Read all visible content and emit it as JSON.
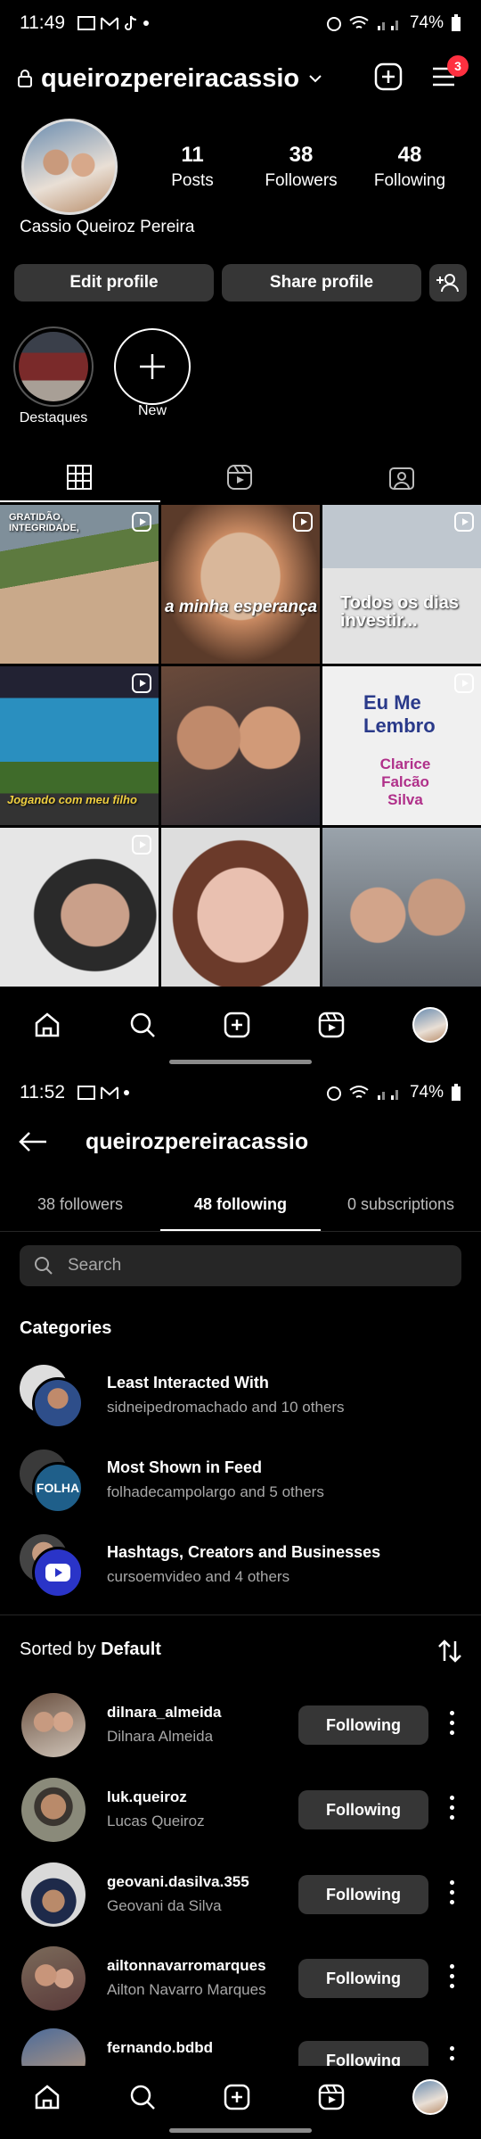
{
  "screen1": {
    "status": {
      "time": "11:49",
      "battery": "74%"
    },
    "header": {
      "username": "queirozpereiracassio",
      "badge": "3"
    },
    "stats": [
      {
        "num": "11",
        "label": "Posts"
      },
      {
        "num": "38",
        "label": "Followers"
      },
      {
        "num": "48",
        "label": "Following"
      }
    ],
    "full_name": "Cassio Queiroz Pereira",
    "buttons": {
      "edit": "Edit profile",
      "share": "Share profile"
    },
    "highlights": [
      {
        "label": "Destaques"
      },
      {
        "label": "New"
      }
    ],
    "grid_overlays": {
      "c1": "GRATIDÃO, INTEGRIDADE,",
      "c2": "a minha esperança",
      "c3": "Todos os dias investir...",
      "c4": "Jogando com meu filho",
      "c6a": "Eu Me Lembro",
      "c6b": "Clarice Falcão Silva"
    }
  },
  "screen2": {
    "status": {
      "time": "11:52",
      "battery": "74%"
    },
    "header": {
      "title": "queirozpereiracassio"
    },
    "tabs": [
      {
        "label": "38 followers"
      },
      {
        "label": "48 following"
      },
      {
        "label": "0 subscriptions"
      }
    ],
    "search_placeholder": "Search",
    "categories_title": "Categories",
    "categories": [
      {
        "title": "Least Interacted With",
        "sub": "sidneipedromachado and 10 others"
      },
      {
        "title": "Most Shown in Feed",
        "sub": "folhadecampolargo and 5 others"
      },
      {
        "title": "Hashtags, Creators and Businesses",
        "sub": "cursoemvideo and 4 others"
      }
    ],
    "sorted": {
      "prefix": "Sorted by",
      "value": "Default"
    },
    "following": [
      {
        "user": "dilnara_almeida",
        "name": "Dilnara Almeida",
        "button": "Following"
      },
      {
        "user": "luk.queiroz",
        "name": "Lucas Queiroz",
        "button": "Following"
      },
      {
        "user": "geovani.dasilva.355",
        "name": "Geovani da Silva",
        "button": "Following"
      },
      {
        "user": "ailtonnavarromarques",
        "name": "Ailton Navarro Marques",
        "button": "Following"
      },
      {
        "user": "fernando.bdbd",
        "name": "",
        "button": "Following"
      }
    ],
    "folha_logo": "FOLHA"
  }
}
